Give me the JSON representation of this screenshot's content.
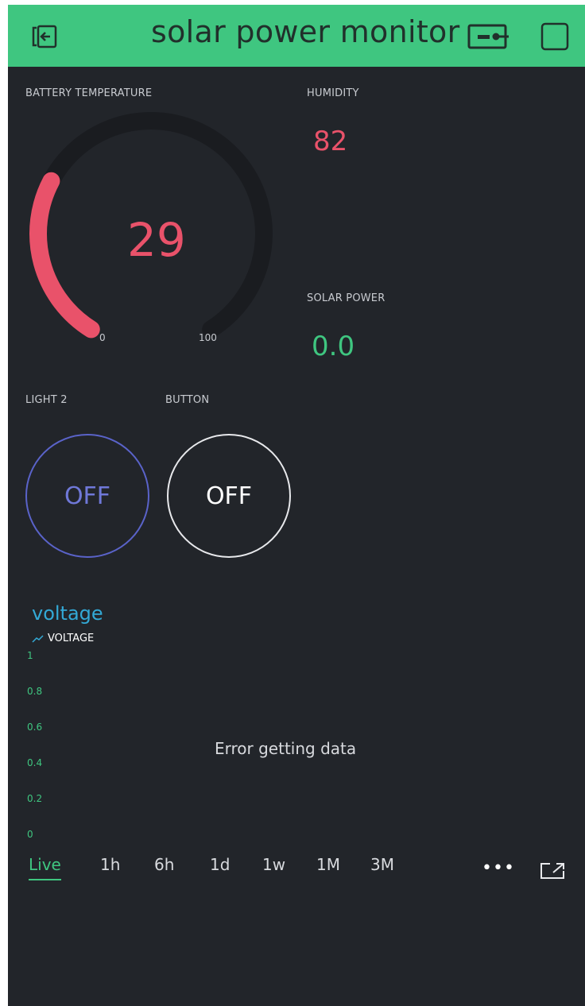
{
  "app": {
    "title": "solar power monitor",
    "accent_color": "#3fc680",
    "background_color": "#22252a",
    "icons": {
      "left": "exit-icon",
      "device": "device-status-icon",
      "right": "square-icon"
    }
  },
  "widgets": {
    "gauge": {
      "label": "BATTERY TEMPERATURE",
      "value": "29",
      "min": "0",
      "max": "100",
      "fill_fraction": 0.29,
      "color": "#e9526a"
    },
    "humidity": {
      "label": "HUMIDITY",
      "value": "82",
      "color": "#e9526a"
    },
    "solar_power": {
      "label": "SOLAR POWER",
      "value": "0.0",
      "color": "#3fc680"
    },
    "light2": {
      "label": "LIGHT 2",
      "state": "OFF",
      "color": "#5a63c9"
    },
    "button": {
      "label": "BUTTON",
      "state": "OFF",
      "color": "#ffffff"
    }
  },
  "chart": {
    "title": "voltage",
    "legend": "VOLTAGE",
    "error": "Error getting data",
    "y_ticks": [
      "1",
      "0.8",
      "0.6",
      "0.4",
      "0.2",
      "0"
    ],
    "ranges": [
      "Live",
      "1h",
      "6h",
      "1d",
      "1w",
      "1M",
      "3M"
    ],
    "active_range": "Live",
    "more": "•••"
  },
  "chart_data": {
    "type": "line",
    "title": "voltage",
    "series": [
      {
        "name": "VOLTAGE",
        "values": []
      }
    ],
    "ylim": [
      0,
      1
    ],
    "yticks": [
      "1",
      "0.8",
      "0.6",
      "0.4",
      "0.2",
      "0"
    ],
    "grid": false,
    "legend": "top-left"
  }
}
